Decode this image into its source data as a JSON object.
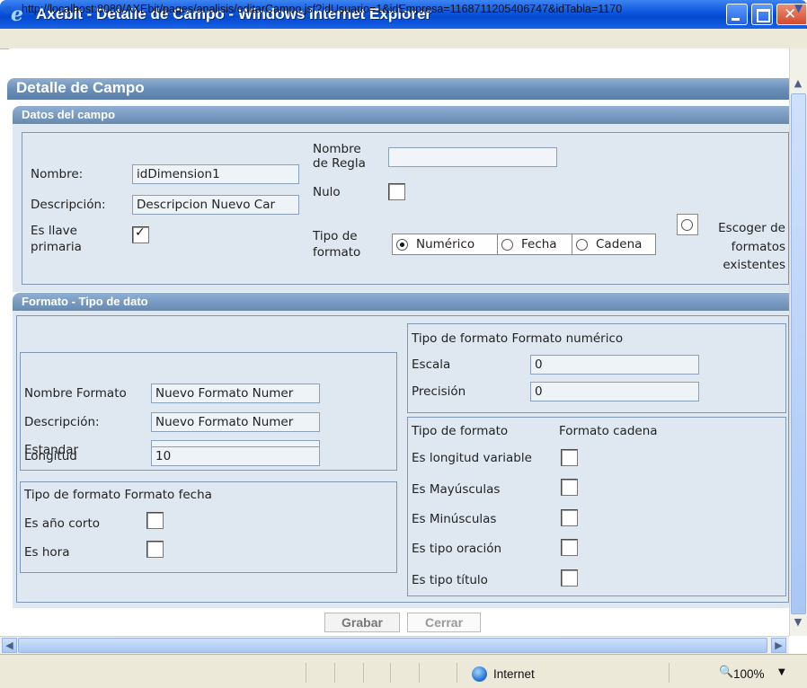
{
  "window": {
    "title": "Axebit - Detalle de Campo - Windows Internet Explorer",
    "address": "http://localhost:8080/AXEbit/pages/analisis/editarCampo.jsf?idUsuario=1&idEmpresa=1168711205406747&idTabla=1170"
  },
  "page": {
    "title": "Detalle de Campo"
  },
  "campo": {
    "section_title": "Datos del campo",
    "nombre_label": "Nombre:",
    "nombre_value": "idDimension1",
    "descripcion_label": "Descripción:",
    "descripcion_value": "Descripcion Nuevo Car",
    "llave_label_1": "Es llave",
    "llave_label_2": "primaria",
    "llave_checked": true,
    "regla_label_1": "Nombre",
    "regla_label_2": "de Regla",
    "regla_value": "",
    "nulo_label": "Nulo",
    "nulo_checked": false,
    "tipo_label_1": "Tipo de",
    "tipo_label_2": "formato",
    "tipo_options": [
      "Numérico",
      "Fecha",
      "Cadena"
    ],
    "tipo_selected": "Numérico",
    "escoger_label_1": "Escoger de",
    "escoger_label_2": "formatos",
    "escoger_label_3": "existentes"
  },
  "formato": {
    "section_title": "Formato - Tipo de dato",
    "nombre_label": "Nombre Formato",
    "nombre_value": "Nuevo Formato Numer",
    "descripcion_label": "Descripción:",
    "descripcion_value": "Nuevo Formato Numer",
    "estandar_label": "Estandar",
    "estandar_value": "",
    "longitud_label": "Longitud",
    "longitud_value": "10",
    "fecha_title": "Tipo de formato Formato fecha",
    "ano_corto_label": "Es año corto",
    "hora_label": "Es hora",
    "numerico_title": "Tipo de formato Formato numérico",
    "escala_label": "Escala",
    "escala_value": "0",
    "precision_label": "Precisión",
    "precision_value": "0",
    "cadena_title_1": "Tipo de formato",
    "cadena_title_2": "Formato cadena",
    "long_variable_label": "Es longitud variable",
    "mayusculas_label": "Es Mayúsculas",
    "minusculas_label": "Es Minúsculas",
    "oracion_label": "Es tipo oración",
    "titulo_label": "Es tipo título"
  },
  "buttons": {
    "grabar": "Grabar",
    "cerrar": "Cerrar"
  },
  "status": {
    "zone": "Internet",
    "zoom": "100%"
  }
}
